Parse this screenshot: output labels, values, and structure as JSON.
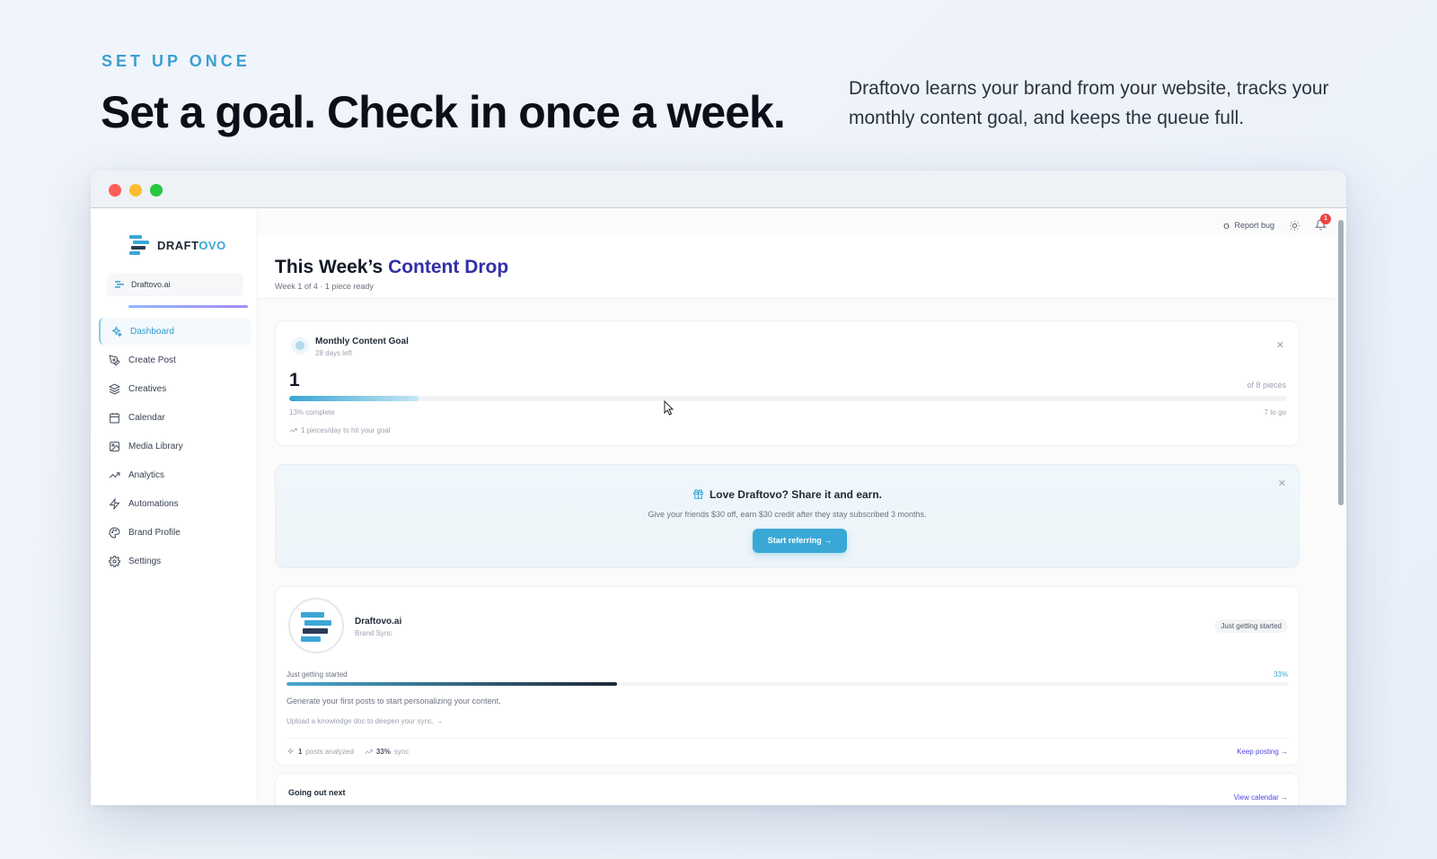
{
  "hero": {
    "eyebrow": "SET UP ONCE",
    "title": "Set a goal. Check in once a week.",
    "description": "Draftovo learns your brand from your website, tracks your monthly content goal, and keeps the queue full."
  },
  "app": {
    "logo": {
      "prefix": "DRAFT",
      "suffix": "OVO"
    },
    "workspace": "Draftovo.ai",
    "nav": [
      {
        "label": "Dashboard",
        "icon": "sparkles-icon",
        "active": true
      },
      {
        "label": "Create Post",
        "icon": "pen-tool-icon"
      },
      {
        "label": "Creatives",
        "icon": "layers-icon"
      },
      {
        "label": "Calendar",
        "icon": "calendar-icon"
      },
      {
        "label": "Media Library",
        "icon": "image-plus-icon"
      },
      {
        "label": "Analytics",
        "icon": "trending-up-icon"
      },
      {
        "label": "Automations",
        "icon": "lightning-icon"
      },
      {
        "label": "Brand Profile",
        "icon": "palette-icon"
      },
      {
        "label": "Settings",
        "icon": "gear-icon"
      }
    ],
    "topbar": {
      "report_bug": "Report bug",
      "notifications": "1"
    }
  },
  "page": {
    "title_main": "This Week’s ",
    "title_accent": "Content Drop",
    "subtitle": "Week 1 of 4 · 1 piece ready"
  },
  "goal": {
    "title": "Monthly Content Goal",
    "days_left": "28 days left",
    "count": "1",
    "of_label": "of 8 pieces",
    "progress": 13,
    "percent_label": "13% complete",
    "to_go": "7 to go",
    "pace": "1 pieces/day to hit your goal"
  },
  "referral": {
    "title": "Love Draftovo? Share it and earn.",
    "description": "Give your friends $30 off, earn $30 credit after they stay subscribed 3 months.",
    "button": "Start referring →"
  },
  "brand": {
    "name": "Draftovo.ai",
    "sub": "Brand Sync",
    "badge": "Just getting started",
    "level": "Just getting started",
    "percent": "33%",
    "progress": 33,
    "hint": "Generate your first posts to start personalizing your content.",
    "link": "Upload a knowledge doc to deepen your sync. →",
    "stats": {
      "posts_count": "1",
      "posts_label": "posts analyzed",
      "sync_count": "33%",
      "sync_label": "sync"
    },
    "keep_posting": "Keep posting →"
  },
  "next": {
    "title": "Going out next",
    "link": "View calendar →"
  },
  "colors": {
    "accent": "#3aa8d6",
    "indigo": "#322fa8",
    "badge_red": "#ef4444"
  }
}
